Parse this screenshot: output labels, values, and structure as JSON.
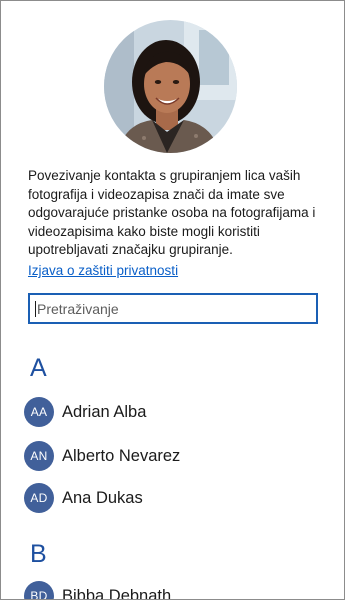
{
  "profile": {
    "photo_icon": "person-photo",
    "description": "Povezivanje kontakta s grupiranjem lica vaših fotografija i videozapisa znači da imate sve odgovarajuće pristanke osoba na fotografijama i videozapisima kako biste mogli koristiti upotrebljavati značajku grupiranje.",
    "privacy_link": "Izjava o zaštiti privatnosti"
  },
  "search": {
    "placeholder": "Pretraživanje"
  },
  "groups": [
    {
      "letter": "A",
      "contacts": [
        {
          "initials": "AA",
          "name": "Adrian Alba"
        },
        {
          "initials": "AN",
          "name": "Alberto Nevarez"
        },
        {
          "initials": "AD",
          "name": "Ana Dukas"
        }
      ]
    },
    {
      "letter": "B",
      "contacts": [
        {
          "initials": "BD",
          "name": "Bibba Debnath"
        }
      ]
    }
  ],
  "colors": {
    "accent": "#1a5fb4",
    "avatar_bg": "#41609a",
    "group_letter": "#1e50a0",
    "link": "#0a5fc8"
  }
}
